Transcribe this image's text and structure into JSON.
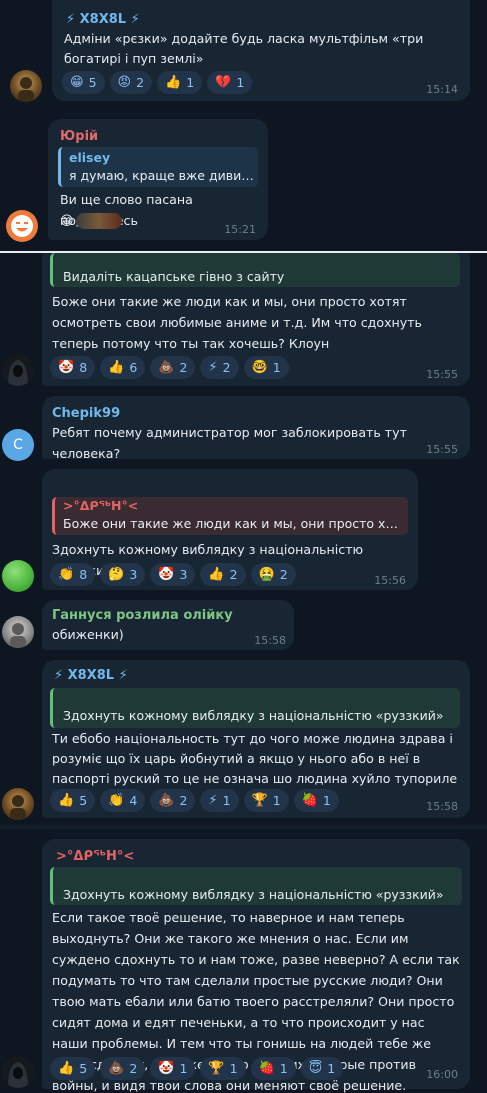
{
  "top": {
    "m1": {
      "name": "⚡ X8X8L ⚡",
      "text": "Адміни «рєзки» додайте будь ласка мультфільм «три богатирі і пуп землі»",
      "reactions": [
        {
          "emoji": "😁",
          "count": "5"
        },
        {
          "emoji": "😡",
          "count": "2"
        },
        {
          "emoji": "👍",
          "count": "1"
        },
        {
          "emoji": "💔",
          "count": "1"
        }
      ],
      "time": "15:14"
    },
    "m2": {
      "name": "Юрій",
      "reply_name": "elisey",
      "reply_text": "я думаю, краще вже дивитись...",
      "text": "Ви ще слово пасана подивитесь",
      "time": "15:21"
    }
  },
  "bottom": {
    "m3": {
      "reply_text": "Видаліть кацапське гівно з сайту",
      "text": "Боже они такие же люди как и мы, они просто хотят осмотреть свои любимые аниме и т.д. Им что сдохнуть теперь потому что ты так хочешь? Клоун",
      "reactions": [
        {
          "emoji": "🤡",
          "count": "8"
        },
        {
          "emoji": "👍",
          "count": "6"
        },
        {
          "emoji": "💩",
          "count": "2"
        },
        {
          "emoji": "⚡",
          "count": "2"
        },
        {
          "emoji": "🤓",
          "count": "1"
        }
      ],
      "time": "15:55"
    },
    "m4": {
      "avatar_letter": "C",
      "name": "Chepik99",
      "text": "Ребят почему администратор мог заблокировать тут человека?",
      "time": "15:55"
    },
    "m5": {
      "reply_name": ">°ᐃᑭᖅᕼ°<",
      "reply_text": "Боже они такие же люди как и мы, они просто хотят ...",
      "text": "Здохнуть кожному виблядку з національністю «руззкий»",
      "reactions": [
        {
          "emoji": "👏",
          "count": "8"
        },
        {
          "emoji": "🤔",
          "count": "3"
        },
        {
          "emoji": "🤡",
          "count": "3"
        },
        {
          "emoji": "👍",
          "count": "2"
        },
        {
          "emoji": "🤮",
          "count": "2"
        }
      ],
      "time": "15:56"
    },
    "m6": {
      "name": "Ганнуся розлила олійку",
      "text": "обиженки)",
      "time": "15:58"
    },
    "m7": {
      "name": "⚡ X8X8L ⚡",
      "reply_text": "Здохнуть кожному виблядку з національністю «руззкий»",
      "text": "Ти ебобо національность тут до чого може людина здрава і розуміє що їх царь йобнутий  а якщо у нього або в неї в паспорті руский то це не означа шо людина хуйло тупориле",
      "reactions": [
        {
          "emoji": "👍",
          "count": "5"
        },
        {
          "emoji": "👏",
          "count": "4"
        },
        {
          "emoji": "💩",
          "count": "2"
        },
        {
          "emoji": "⚡",
          "count": "1"
        },
        {
          "emoji": "🏆",
          "count": "1"
        },
        {
          "emoji": "🍓",
          "count": "1"
        }
      ],
      "time": "15:58"
    },
    "m8": {
      "name": ">°ᐃᑭᖅᕼ°<",
      "reply_text": "Здохнуть кожному виблядку з національністю «руззкий»",
      "text": "Если такое твоё решение, то наверное и нам теперь выходнуть? Они же такого же мнения о нас. Если им суждено сдохнуть то и нам тоже, разве неверно? А если так подумать то что там сделали простые русские люди? Они твою мать ебали или батю твоего расстреляли? Они просто сидят дома и едят печеньки, а то что происходит у нас наши проблемы. И тем что ты гонишь на людей тебе же хуже сделает, есть же много русских которые против войны, и видя твои слова они меняют своё решение.",
      "reactions": [
        {
          "emoji": "👍",
          "count": "5"
        },
        {
          "emoji": "💩",
          "count": "2"
        },
        {
          "emoji": "🤡",
          "count": "1"
        },
        {
          "emoji": "🏆",
          "count": "1"
        },
        {
          "emoji": "🍓",
          "count": "1"
        },
        {
          "emoji": "😇",
          "count": "1"
        }
      ],
      "time": "16:00"
    }
  },
  "colors": {
    "background": "#0e1621",
    "bubble": "#182533",
    "reaction_chip": "#223449",
    "reaction_count": "#8bc1f5",
    "time": "#6b7d8f",
    "name_blue": "#72b8ec",
    "name_red": "#e26a6a",
    "name_green": "#7fc684",
    "quote_green_bg": "#1f3a36",
    "quote_green_bar": "#5fc17a",
    "quote_red_bg": "#3a2a31",
    "quote_red_bar": "#e46464"
  }
}
